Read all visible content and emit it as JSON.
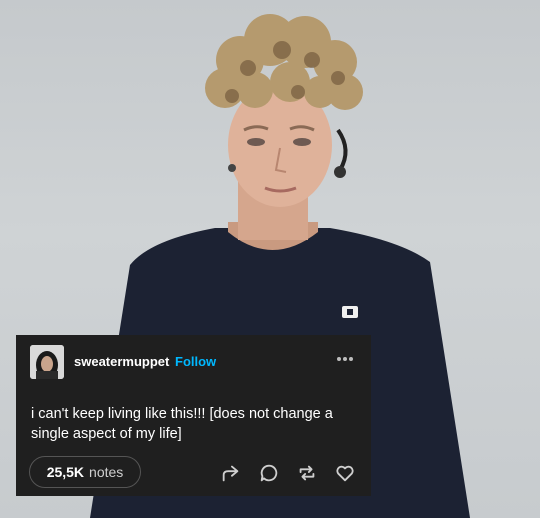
{
  "post": {
    "username": "sweatermuppet",
    "follow_label": "Follow",
    "body": "i can't keep living like this!!! [does not change a single aspect of my life]",
    "notes_count": "25,5K",
    "notes_label": "notes"
  },
  "icons": {
    "more": "more-options-icon",
    "share": "share-icon",
    "reply": "reply-icon",
    "reblog": "reblog-icon",
    "like": "heart-icon"
  },
  "colors": {
    "card_bg": "#1f1f1f",
    "follow_accent": "#00b8ff",
    "photo_bg": "#c9cdcf",
    "sweater": "#1c2233"
  }
}
